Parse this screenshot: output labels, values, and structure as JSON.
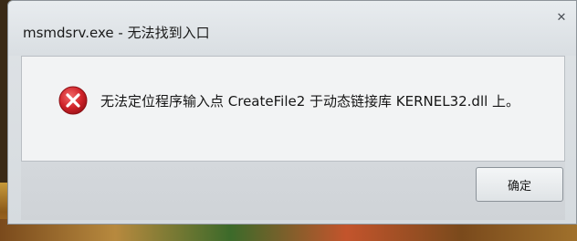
{
  "window": {
    "title": "msmdsrv.exe - 无法找到入口",
    "close_symbol": "✕"
  },
  "dialog": {
    "icon": "error-icon",
    "message": "无法定位程序输入点 CreateFile2 于动态链接库 KERNEL32.dll 上。",
    "ok_label": "确定"
  },
  "colors": {
    "error_red": "#d0232a",
    "window_bg": "#d9dee2",
    "content_bg": "#f2f3f4"
  }
}
